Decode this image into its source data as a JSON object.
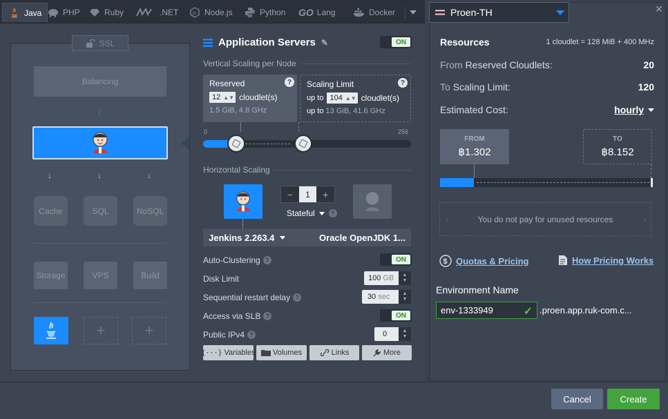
{
  "tabs": [
    {
      "label": "Java",
      "icon": "java-icon"
    },
    {
      "label": "PHP",
      "icon": "php-elephant-icon"
    },
    {
      "label": "Ruby",
      "icon": "ruby-icon"
    },
    {
      "label": ".NET",
      "icon": "dotnet-icon"
    },
    {
      "label": "Node.js",
      "icon": "nodejs-icon"
    },
    {
      "label": "Python",
      "icon": "python-icon"
    },
    {
      "label": "Lang",
      "icon": "go-icon",
      "prefix": "GO"
    },
    {
      "label": "Docker",
      "icon": "docker-icon"
    }
  ],
  "topology": {
    "ssl_label": "SSL",
    "balancing_label": "Balancing",
    "cache_label": "Cache",
    "sql_label": "SQL",
    "nosql_label": "NoSQL",
    "storage_label": "Storage",
    "vps_label": "VPS",
    "build_label": "Build"
  },
  "app_servers": {
    "title": "Application Servers",
    "toggle": "ON",
    "vertical_label": "Vertical Scaling per Node",
    "reserved_title": "Reserved",
    "reserved_value": "12",
    "cloudlet_unit": "cloudlet(s)",
    "reserved_specs": "1.5 GiB, 4.8 GHz",
    "limit_title": "Scaling Limit",
    "limit_prefix": "up to",
    "limit_value": "104",
    "limit_specs_prefix": "up to",
    "limit_specs": "13 GiB, 41.6 GHz",
    "slider_min": "0",
    "slider_max": "256",
    "slider_reserved_fraction": 0.047,
    "slider_limit_fraction": 0.406,
    "horizontal_label": "Horizontal Scaling",
    "node_count": "1",
    "stepper_minus": "−",
    "stepper_plus": "+",
    "stateful_label": "Stateful",
    "version": "Jenkins 2.263.4",
    "jdk": "Oracle OpenJDK 1...",
    "auto_clustering_label": "Auto-Clustering",
    "auto_clustering_toggle": "ON",
    "disk_limit_label": "Disk Limit",
    "disk_limit_value": "100",
    "disk_limit_unit": "GB",
    "restart_delay_label": "Sequential restart delay",
    "restart_delay_value": "30",
    "restart_delay_unit": "sec",
    "slb_label": "Access via SLB",
    "slb_toggle": "ON",
    "ipv4_label": "Public IPv4",
    "ipv4_value": "0",
    "buttons": {
      "variables": "Variables",
      "volumes": "Volumes",
      "links": "Links",
      "more": "More"
    }
  },
  "resources": {
    "region": "Proen-TH",
    "title": "Resources",
    "cloudlet_info": "1 cloudlet = 128 MiB + 400 MHz",
    "reserved_label_prefix": "From",
    "reserved_label": "Reserved Cloudlets:",
    "reserved_value": "20",
    "limit_label_prefix": "To",
    "limit_label": "Scaling Limit:",
    "limit_value": "120",
    "estimated_label": "Estimated Cost:",
    "period": "hourly",
    "from_label": "FROM",
    "from_price": "฿1.302",
    "to_label": "TO",
    "to_price": "฿8.152",
    "cost_fill_fraction": 0.16,
    "unused_text": "You do not pay for unused resources",
    "quotas_link": "Quotas & Pricing",
    "pricing_link": "How Pricing Works",
    "env_name_label": "Environment Name",
    "env_name_value": "env-1333949",
    "env_suffix": ".proen.app.ruk-com.c..."
  },
  "footer": {
    "cancel": "Cancel",
    "create": "Create"
  },
  "colors": {
    "accent": "#1a8cff",
    "create": "#43a33e",
    "cancel": "#5b6a82",
    "on": "#2f8a2f"
  }
}
